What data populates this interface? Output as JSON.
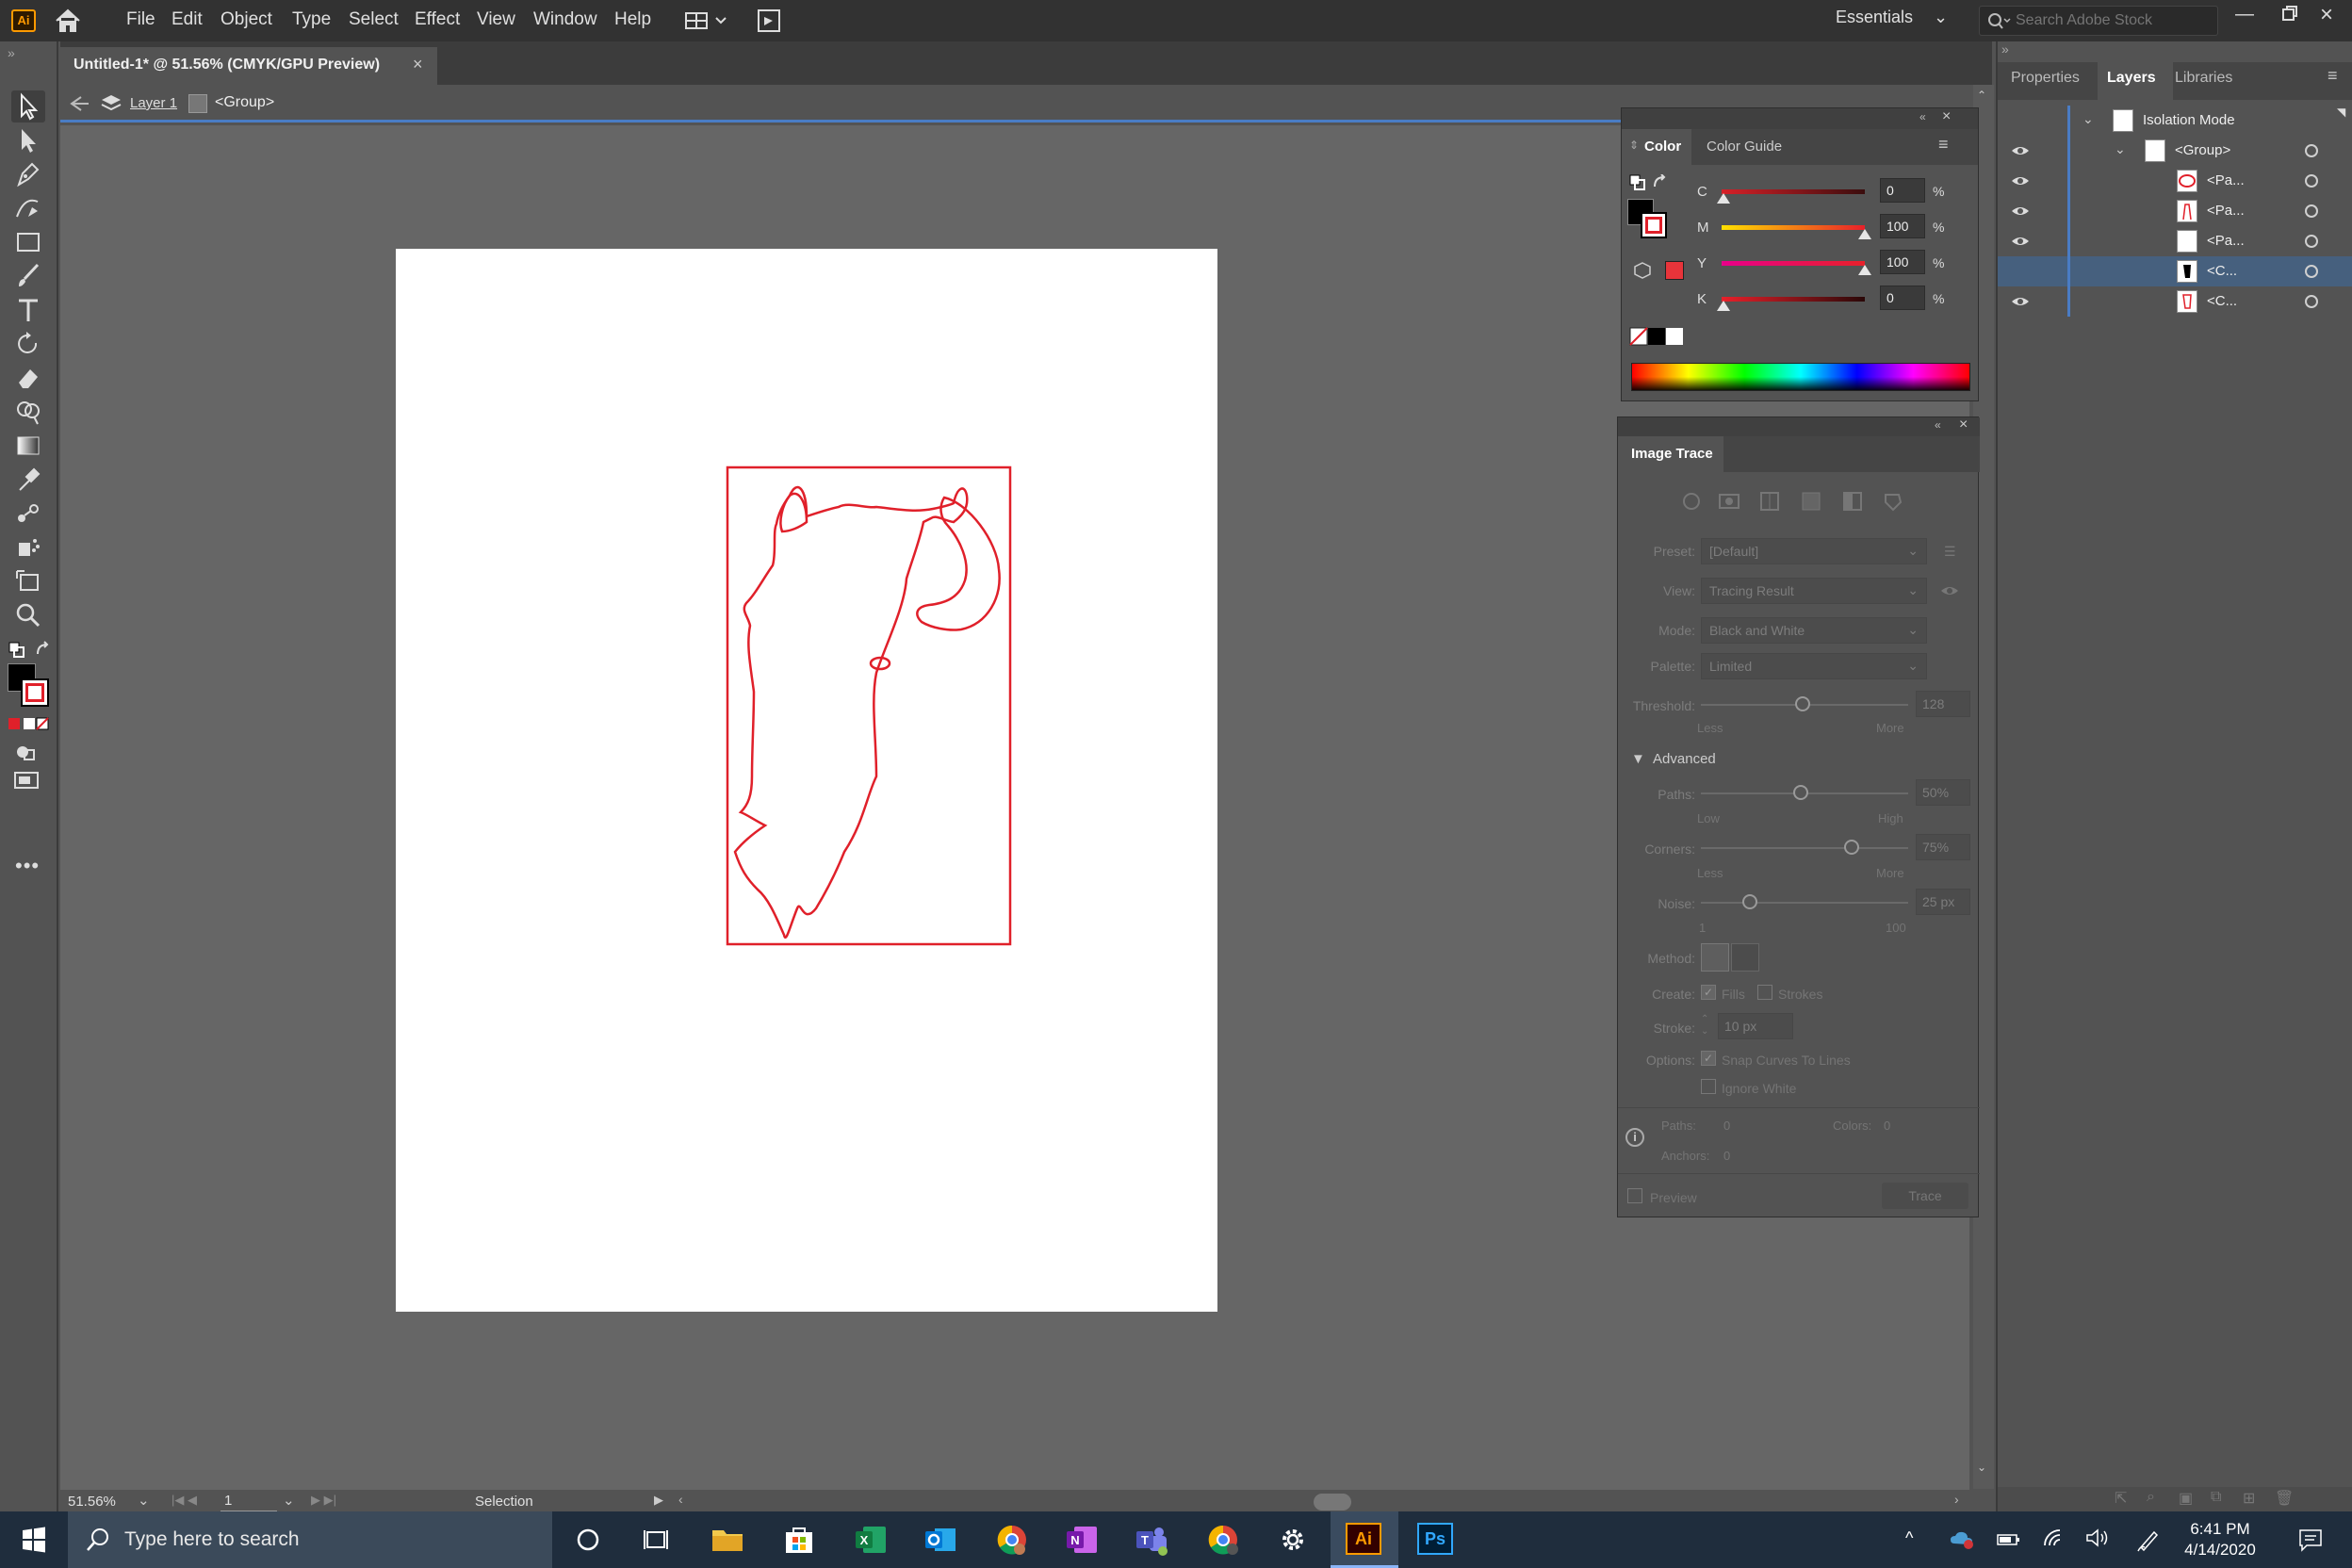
{
  "app": {
    "logo": "Ai"
  },
  "menu": [
    "File",
    "Edit",
    "Object",
    "Type",
    "Select",
    "Effect",
    "View",
    "Window",
    "Help"
  ],
  "workspace": "Essentials",
  "stock_search_placeholder": "Search Adobe Stock",
  "document": {
    "tab_title": "Untitled-1* @ 51.56% (CMYK/GPU Preview)",
    "close": "×"
  },
  "isolation": {
    "layer": "Layer 1",
    "group": "<Group>"
  },
  "status": {
    "zoom": "51.56%",
    "artboard": "1",
    "tool": "Selection"
  },
  "right_tabs": [
    "Properties",
    "Layers",
    "Libraries"
  ],
  "layers": {
    "header": "Isolation Mode",
    "rows": [
      {
        "name": "<Group>"
      },
      {
        "name": "<Pa..."
      },
      {
        "name": "<Pa..."
      },
      {
        "name": "<Pa..."
      },
      {
        "name": "<C..."
      },
      {
        "name": "<C..."
      }
    ]
  },
  "color_panel": {
    "tabs": [
      "Color",
      "Color Guide"
    ],
    "sliders": [
      {
        "label": "C",
        "value": "0",
        "unit": "%"
      },
      {
        "label": "M",
        "value": "100",
        "unit": "%"
      },
      {
        "label": "Y",
        "value": "100",
        "unit": "%"
      },
      {
        "label": "K",
        "value": "0",
        "unit": "%"
      }
    ]
  },
  "image_trace": {
    "title": "Image Trace",
    "preset_label": "Preset:",
    "preset_value": "[Default]",
    "view_label": "View:",
    "view_value": "Tracing Result",
    "mode_label": "Mode:",
    "mode_value": "Black and White",
    "palette_label": "Palette:",
    "palette_value": "Limited",
    "threshold_label": "Threshold:",
    "threshold_value": "128",
    "threshold_min": "Less",
    "threshold_max": "More",
    "advanced": "Advanced",
    "paths_label": "Paths:",
    "paths_value": "50%",
    "paths_min": "Low",
    "paths_max": "High",
    "corners_label": "Corners:",
    "corners_value": "75%",
    "corners_min": "Less",
    "corners_max": "More",
    "noise_label": "Noise:",
    "noise_value": "25 px",
    "noise_min": "1",
    "noise_max": "100",
    "method_label": "Method:",
    "create_label": "Create:",
    "fills": "Fills",
    "strokes": "Strokes",
    "stroke_label": "Stroke:",
    "stroke_value": "10 px",
    "options_label": "Options:",
    "snap": "Snap Curves To Lines",
    "ignore_white": "Ignore White",
    "paths_stat_label": "Paths:",
    "paths_stat": "0",
    "colors_stat_label": "Colors:",
    "colors_stat": "0",
    "anchors_stat_label": "Anchors:",
    "anchors_stat": "0",
    "preview": "Preview",
    "trace_button": "Trace"
  },
  "taskbar": {
    "search_placeholder": "Type here to search",
    "time": "6:41 PM",
    "date": "4/14/2020",
    "ai_label": "Ai",
    "ps_label": "Ps"
  },
  "colors": {
    "accent": "#4a7cc4",
    "stroke_red": "#e0202a"
  }
}
